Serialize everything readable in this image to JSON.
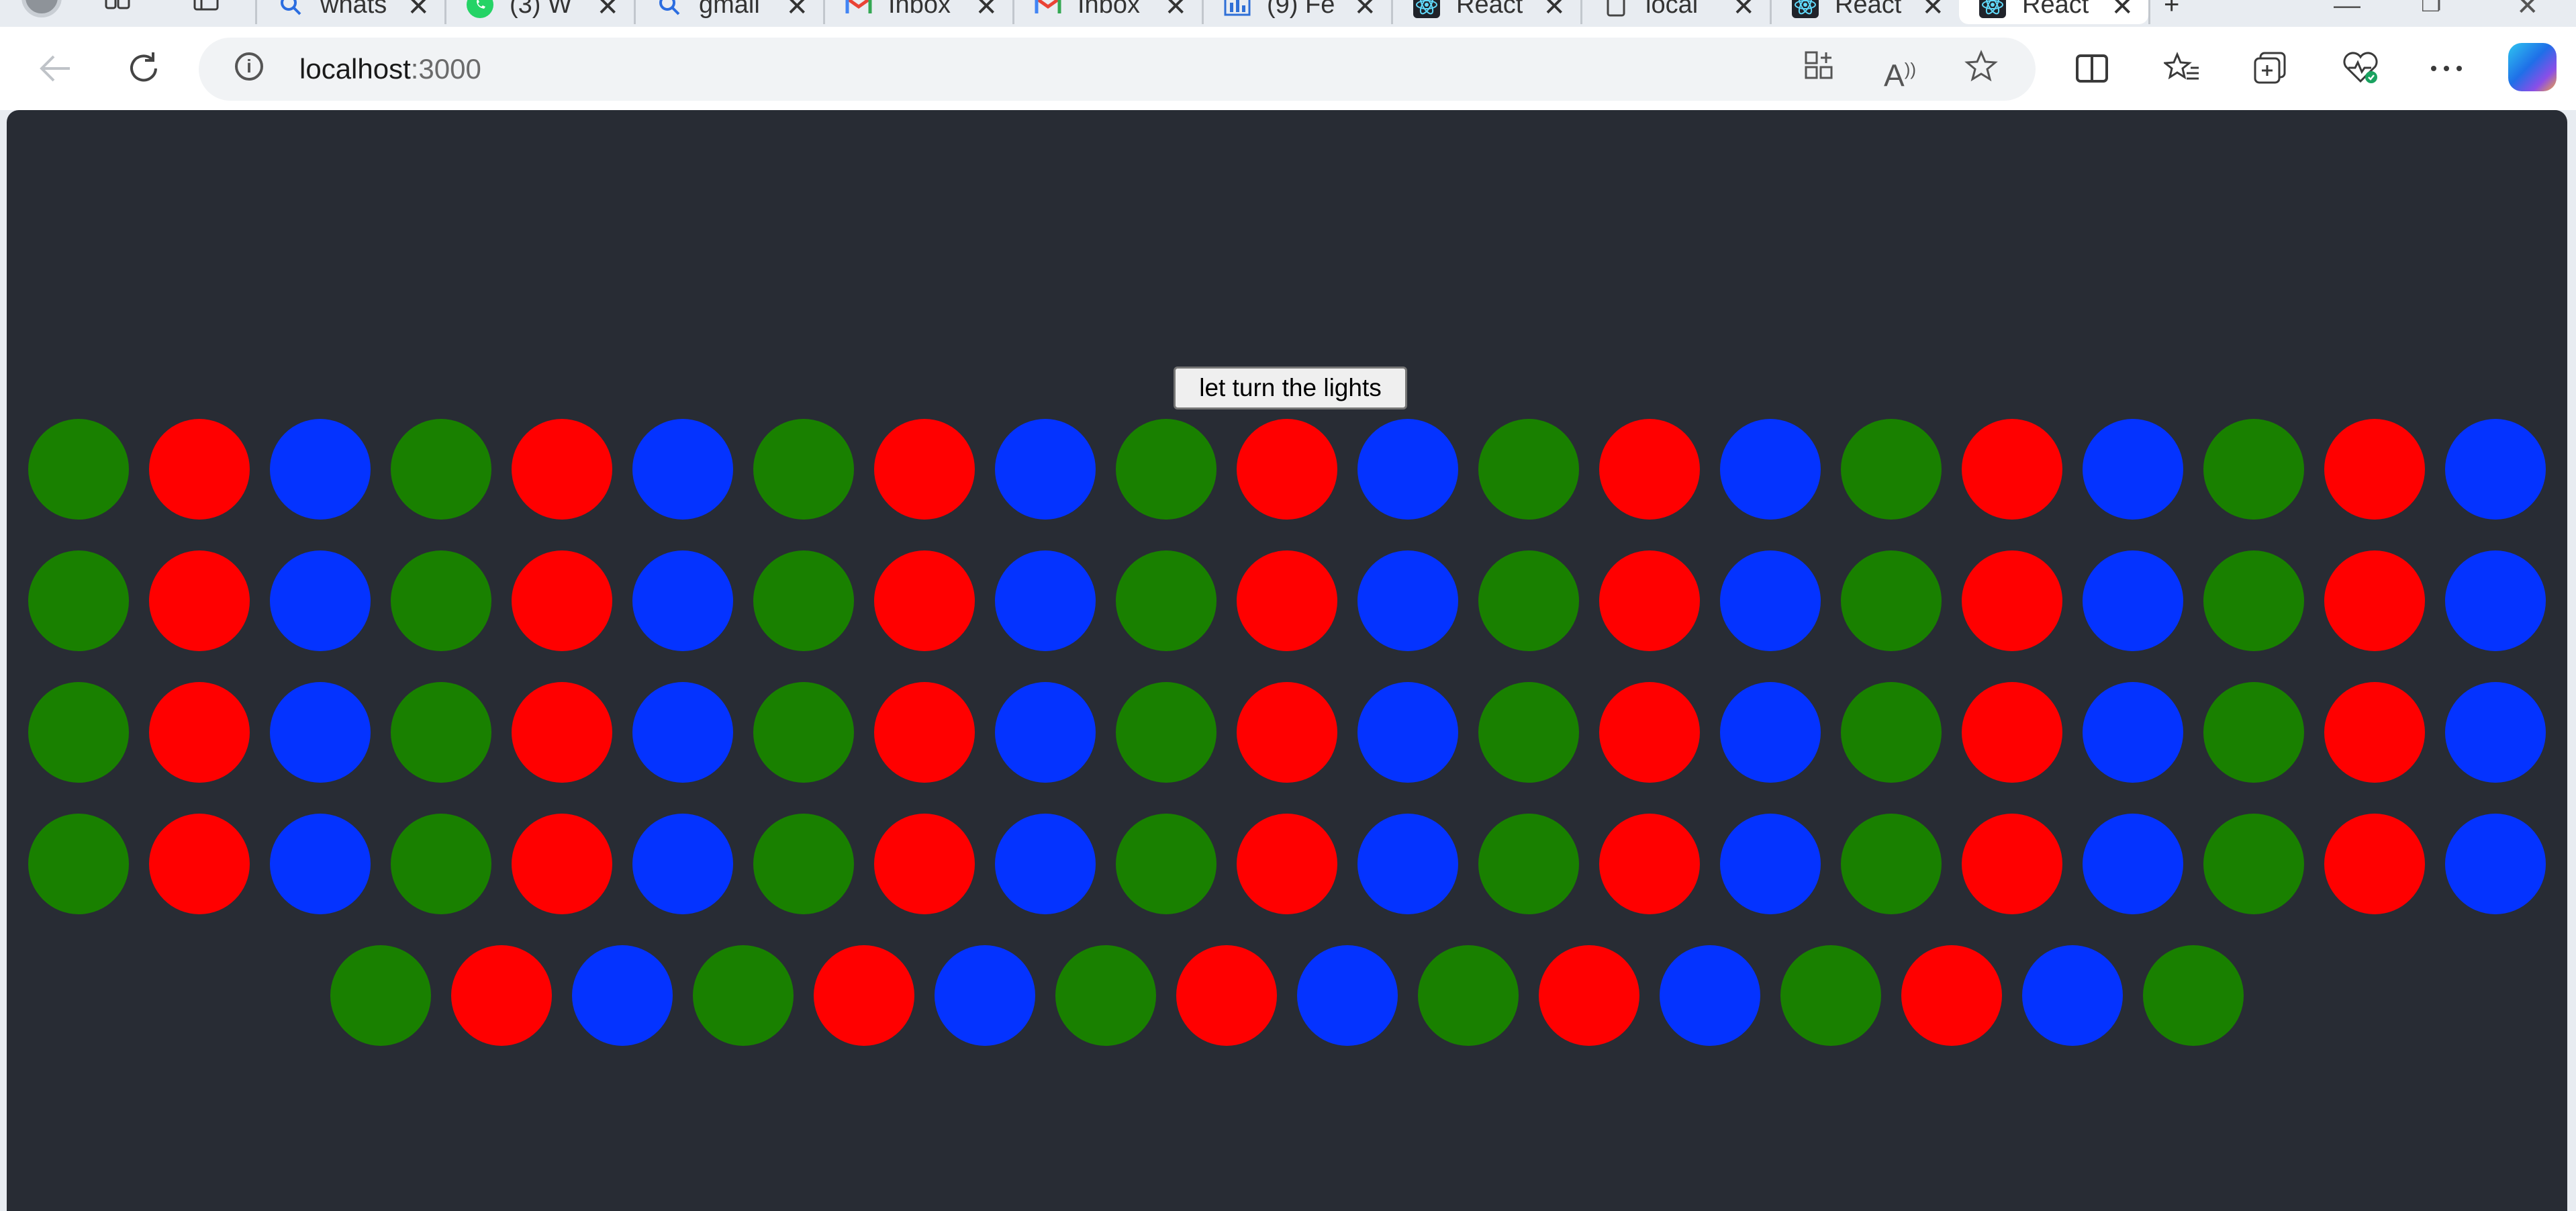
{
  "browser": {
    "tabs": [
      {
        "title": "whats",
        "favicon": "search-icon",
        "active": false
      },
      {
        "title": "(3) W",
        "favicon": "whatsapp-icon",
        "active": false
      },
      {
        "title": "gmail",
        "favicon": "search-icon",
        "active": false
      },
      {
        "title": "Inbox",
        "favicon": "gmail-icon",
        "active": false
      },
      {
        "title": "Inbox",
        "favicon": "gmail-icon",
        "active": false
      },
      {
        "title": "(9) Fe",
        "favicon": "chart-icon",
        "active": false
      },
      {
        "title": "React",
        "favicon": "react-icon",
        "active": false
      },
      {
        "title": "local",
        "favicon": "page-icon",
        "active": false
      },
      {
        "title": "React",
        "favicon": "react-icon",
        "active": false
      },
      {
        "title": "React",
        "favicon": "react-icon",
        "active": true
      }
    ],
    "close_glyph": "✕",
    "new_tab_glyph": "+",
    "address": {
      "host": "localhost",
      "port": ":3000"
    }
  },
  "page": {
    "background_color": "#282c34",
    "button_label": "let turn the lights",
    "light_colors": {
      "green": "#198000",
      "red": "#ff0000",
      "blue": "#0433ff"
    },
    "color_pattern": [
      "green",
      "red",
      "blue"
    ],
    "light_count": 100
  }
}
